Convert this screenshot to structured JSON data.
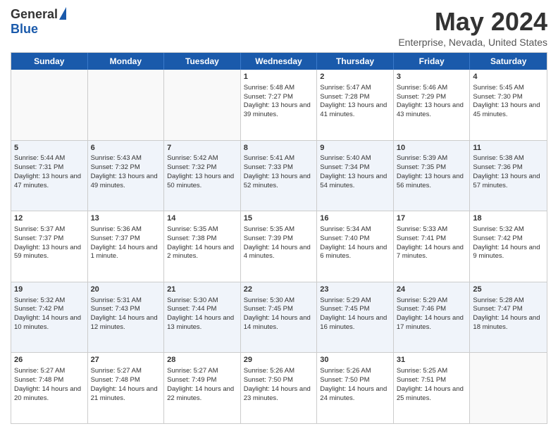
{
  "logo": {
    "general": "General",
    "blue": "Blue"
  },
  "title": "May 2024",
  "location": "Enterprise, Nevada, United States",
  "weekdays": [
    "Sunday",
    "Monday",
    "Tuesday",
    "Wednesday",
    "Thursday",
    "Friday",
    "Saturday"
  ],
  "rows": [
    [
      {
        "day": "",
        "sunrise": "",
        "sunset": "",
        "daylight": ""
      },
      {
        "day": "",
        "sunrise": "",
        "sunset": "",
        "daylight": ""
      },
      {
        "day": "",
        "sunrise": "",
        "sunset": "",
        "daylight": ""
      },
      {
        "day": "1",
        "sunrise": "Sunrise: 5:48 AM",
        "sunset": "Sunset: 7:27 PM",
        "daylight": "Daylight: 13 hours and 39 minutes."
      },
      {
        "day": "2",
        "sunrise": "Sunrise: 5:47 AM",
        "sunset": "Sunset: 7:28 PM",
        "daylight": "Daylight: 13 hours and 41 minutes."
      },
      {
        "day": "3",
        "sunrise": "Sunrise: 5:46 AM",
        "sunset": "Sunset: 7:29 PM",
        "daylight": "Daylight: 13 hours and 43 minutes."
      },
      {
        "day": "4",
        "sunrise": "Sunrise: 5:45 AM",
        "sunset": "Sunset: 7:30 PM",
        "daylight": "Daylight: 13 hours and 45 minutes."
      }
    ],
    [
      {
        "day": "5",
        "sunrise": "Sunrise: 5:44 AM",
        "sunset": "Sunset: 7:31 PM",
        "daylight": "Daylight: 13 hours and 47 minutes."
      },
      {
        "day": "6",
        "sunrise": "Sunrise: 5:43 AM",
        "sunset": "Sunset: 7:32 PM",
        "daylight": "Daylight: 13 hours and 49 minutes."
      },
      {
        "day": "7",
        "sunrise": "Sunrise: 5:42 AM",
        "sunset": "Sunset: 7:32 PM",
        "daylight": "Daylight: 13 hours and 50 minutes."
      },
      {
        "day": "8",
        "sunrise": "Sunrise: 5:41 AM",
        "sunset": "Sunset: 7:33 PM",
        "daylight": "Daylight: 13 hours and 52 minutes."
      },
      {
        "day": "9",
        "sunrise": "Sunrise: 5:40 AM",
        "sunset": "Sunset: 7:34 PM",
        "daylight": "Daylight: 13 hours and 54 minutes."
      },
      {
        "day": "10",
        "sunrise": "Sunrise: 5:39 AM",
        "sunset": "Sunset: 7:35 PM",
        "daylight": "Daylight: 13 hours and 56 minutes."
      },
      {
        "day": "11",
        "sunrise": "Sunrise: 5:38 AM",
        "sunset": "Sunset: 7:36 PM",
        "daylight": "Daylight: 13 hours and 57 minutes."
      }
    ],
    [
      {
        "day": "12",
        "sunrise": "Sunrise: 5:37 AM",
        "sunset": "Sunset: 7:37 PM",
        "daylight": "Daylight: 13 hours and 59 minutes."
      },
      {
        "day": "13",
        "sunrise": "Sunrise: 5:36 AM",
        "sunset": "Sunset: 7:37 PM",
        "daylight": "Daylight: 14 hours and 1 minute."
      },
      {
        "day": "14",
        "sunrise": "Sunrise: 5:35 AM",
        "sunset": "Sunset: 7:38 PM",
        "daylight": "Daylight: 14 hours and 2 minutes."
      },
      {
        "day": "15",
        "sunrise": "Sunrise: 5:35 AM",
        "sunset": "Sunset: 7:39 PM",
        "daylight": "Daylight: 14 hours and 4 minutes."
      },
      {
        "day": "16",
        "sunrise": "Sunrise: 5:34 AM",
        "sunset": "Sunset: 7:40 PM",
        "daylight": "Daylight: 14 hours and 6 minutes."
      },
      {
        "day": "17",
        "sunrise": "Sunrise: 5:33 AM",
        "sunset": "Sunset: 7:41 PM",
        "daylight": "Daylight: 14 hours and 7 minutes."
      },
      {
        "day": "18",
        "sunrise": "Sunrise: 5:32 AM",
        "sunset": "Sunset: 7:42 PM",
        "daylight": "Daylight: 14 hours and 9 minutes."
      }
    ],
    [
      {
        "day": "19",
        "sunrise": "Sunrise: 5:32 AM",
        "sunset": "Sunset: 7:42 PM",
        "daylight": "Daylight: 14 hours and 10 minutes."
      },
      {
        "day": "20",
        "sunrise": "Sunrise: 5:31 AM",
        "sunset": "Sunset: 7:43 PM",
        "daylight": "Daylight: 14 hours and 12 minutes."
      },
      {
        "day": "21",
        "sunrise": "Sunrise: 5:30 AM",
        "sunset": "Sunset: 7:44 PM",
        "daylight": "Daylight: 14 hours and 13 minutes."
      },
      {
        "day": "22",
        "sunrise": "Sunrise: 5:30 AM",
        "sunset": "Sunset: 7:45 PM",
        "daylight": "Daylight: 14 hours and 14 minutes."
      },
      {
        "day": "23",
        "sunrise": "Sunrise: 5:29 AM",
        "sunset": "Sunset: 7:45 PM",
        "daylight": "Daylight: 14 hours and 16 minutes."
      },
      {
        "day": "24",
        "sunrise": "Sunrise: 5:29 AM",
        "sunset": "Sunset: 7:46 PM",
        "daylight": "Daylight: 14 hours and 17 minutes."
      },
      {
        "day": "25",
        "sunrise": "Sunrise: 5:28 AM",
        "sunset": "Sunset: 7:47 PM",
        "daylight": "Daylight: 14 hours and 18 minutes."
      }
    ],
    [
      {
        "day": "26",
        "sunrise": "Sunrise: 5:27 AM",
        "sunset": "Sunset: 7:48 PM",
        "daylight": "Daylight: 14 hours and 20 minutes."
      },
      {
        "day": "27",
        "sunrise": "Sunrise: 5:27 AM",
        "sunset": "Sunset: 7:48 PM",
        "daylight": "Daylight: 14 hours and 21 minutes."
      },
      {
        "day": "28",
        "sunrise": "Sunrise: 5:27 AM",
        "sunset": "Sunset: 7:49 PM",
        "daylight": "Daylight: 14 hours and 22 minutes."
      },
      {
        "day": "29",
        "sunrise": "Sunrise: 5:26 AM",
        "sunset": "Sunset: 7:50 PM",
        "daylight": "Daylight: 14 hours and 23 minutes."
      },
      {
        "day": "30",
        "sunrise": "Sunrise: 5:26 AM",
        "sunset": "Sunset: 7:50 PM",
        "daylight": "Daylight: 14 hours and 24 minutes."
      },
      {
        "day": "31",
        "sunrise": "Sunrise: 5:25 AM",
        "sunset": "Sunset: 7:51 PM",
        "daylight": "Daylight: 14 hours and 25 minutes."
      },
      {
        "day": "",
        "sunrise": "",
        "sunset": "",
        "daylight": ""
      }
    ]
  ]
}
